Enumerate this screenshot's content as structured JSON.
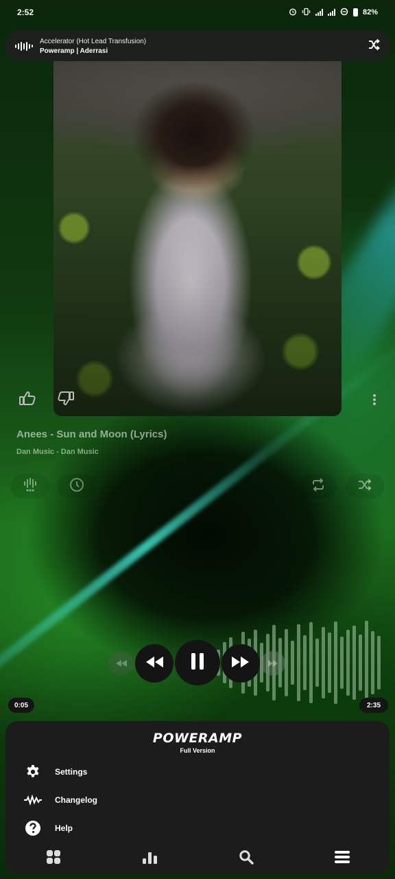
{
  "status_bar": {
    "time": "2:52",
    "battery": "82%",
    "icons": [
      "alarm-icon",
      "vibrate-icon",
      "signal-icon",
      "signal-icon",
      "data-saver-icon",
      "battery-icon"
    ]
  },
  "notification": {
    "title": "Accelerator (Hot Lead Transfusion)",
    "subtitle": "Poweramp | Aderrasi",
    "icons": [
      "waveform-icon",
      "shuffle-icon"
    ]
  },
  "player": {
    "track_title": "Anees - Sun and Moon (Lyrics)",
    "track_artist": "Dan Music - Dan Music",
    "elapsed": "0:05",
    "duration": "2:35",
    "icons": [
      "thumbs-up-icon",
      "thumbs-down-icon",
      "more-vert-icon",
      "equalizer-icon",
      "sleep-timer-icon",
      "repeat-icon",
      "shuffle-icon",
      "rewind-icon",
      "pause-icon",
      "fast-forward-icon"
    ]
  },
  "menu": {
    "brand": "POWERAMP",
    "edition": "Full Version",
    "items": [
      {
        "label": "Settings",
        "icon": "gear-icon"
      },
      {
        "label": "Changelog",
        "icon": "waveform-icon"
      },
      {
        "label": "Help",
        "icon": "help-icon"
      }
    ],
    "nav": [
      "grid-icon",
      "bars-icon",
      "search-icon",
      "menu-icon"
    ]
  },
  "colors": {
    "accent_green": "#1c6a1c",
    "panel": "#1c1c1c",
    "control": "#141414"
  }
}
